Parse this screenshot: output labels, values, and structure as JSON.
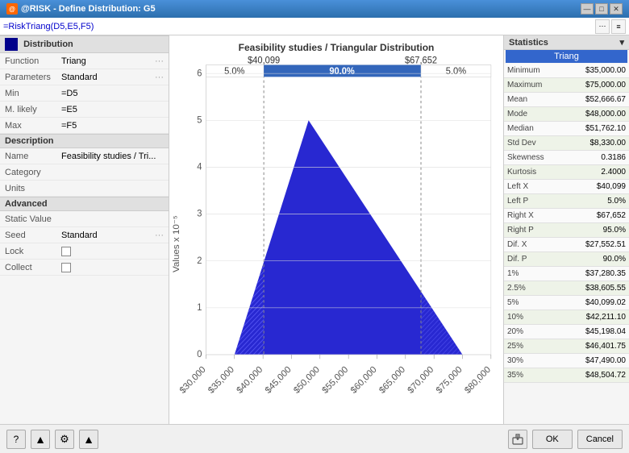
{
  "window": {
    "title": "@RISK - Define Distribution: G5",
    "title_icon": "@"
  },
  "formula_bar": {
    "value": "=RiskTriang(D5,E5,F5)"
  },
  "left_panel": {
    "distribution_header": "Distribution",
    "rows": [
      {
        "label": "Function",
        "value": "Triang",
        "has_dots": true
      },
      {
        "label": "Parameters",
        "value": "Standard",
        "has_dots": true
      },
      {
        "label": "Min",
        "value": "=D5",
        "has_dots": false
      },
      {
        "label": "M. likely",
        "value": "=E5",
        "has_dots": false
      },
      {
        "label": "Max",
        "value": "=F5",
        "has_dots": false
      }
    ],
    "description_header": "Description",
    "desc_rows": [
      {
        "label": "Name",
        "value": "Feasibility studies / Tri..."
      },
      {
        "label": "Category",
        "value": ""
      },
      {
        "label": "Units",
        "value": ""
      }
    ],
    "advanced_header": "Advanced",
    "adv_rows": [
      {
        "label": "Static Value",
        "value": ""
      },
      {
        "label": "Seed",
        "value": "Standard",
        "has_dots": true
      },
      {
        "label": "Lock",
        "value": "",
        "is_checkbox": true
      },
      {
        "label": "Collect",
        "value": "",
        "is_checkbox": true
      }
    ]
  },
  "chart": {
    "title": "Feasibility studies / Triangular Distribution",
    "x_label_min": "$40,099",
    "x_label_max": "$67,652",
    "pct_left": "5.0%",
    "pct_center": "90.0%",
    "pct_right": "5.0%",
    "y_axis_label": "Values x 10⁻⁵",
    "x_ticks": [
      "$30,000",
      "$35,000",
      "$40,000",
      "$45,000",
      "$50,000",
      "$55,000",
      "$60,000",
      "$65,000",
      "$70,000",
      "$75,000",
      "$80,000"
    ]
  },
  "statistics": {
    "header": "Statistics",
    "col_label": "Triang",
    "rows": [
      {
        "name": "Minimum",
        "value": "$35,000.00"
      },
      {
        "name": "Maximum",
        "value": "$75,000.00"
      },
      {
        "name": "Mean",
        "value": "$52,666.67"
      },
      {
        "name": "Mode",
        "value": "$48,000.00"
      },
      {
        "name": "Median",
        "value": "$51,762.10"
      },
      {
        "name": "Std Dev",
        "value": "$8,330.00"
      },
      {
        "name": "Skewness",
        "value": "0.3186"
      },
      {
        "name": "Kurtosis",
        "value": "2.4000"
      },
      {
        "name": "Left X",
        "value": "$40,099"
      },
      {
        "name": "Left P",
        "value": "5.0%"
      },
      {
        "name": "Right X",
        "value": "$67,652"
      },
      {
        "name": "Right P",
        "value": "95.0%"
      },
      {
        "name": "Dif. X",
        "value": "$27,552.51"
      },
      {
        "name": "Dif. P",
        "value": "90.0%"
      },
      {
        "name": "1%",
        "value": "$37,280.35"
      },
      {
        "name": "2.5%",
        "value": "$38,605.55"
      },
      {
        "name": "5%",
        "value": "$40,099.02"
      },
      {
        "name": "10%",
        "value": "$42,211.10"
      },
      {
        "name": "20%",
        "value": "$45,198.04"
      },
      {
        "name": "25%",
        "value": "$46,401.75"
      },
      {
        "name": "30%",
        "value": "$47,490.00"
      },
      {
        "name": "35%",
        "value": "$48,504.72"
      }
    ]
  },
  "bottom_bar": {
    "icons": [
      "?",
      "▲",
      "⚙",
      "▲"
    ],
    "ok_label": "OK",
    "cancel_label": "Cancel"
  }
}
